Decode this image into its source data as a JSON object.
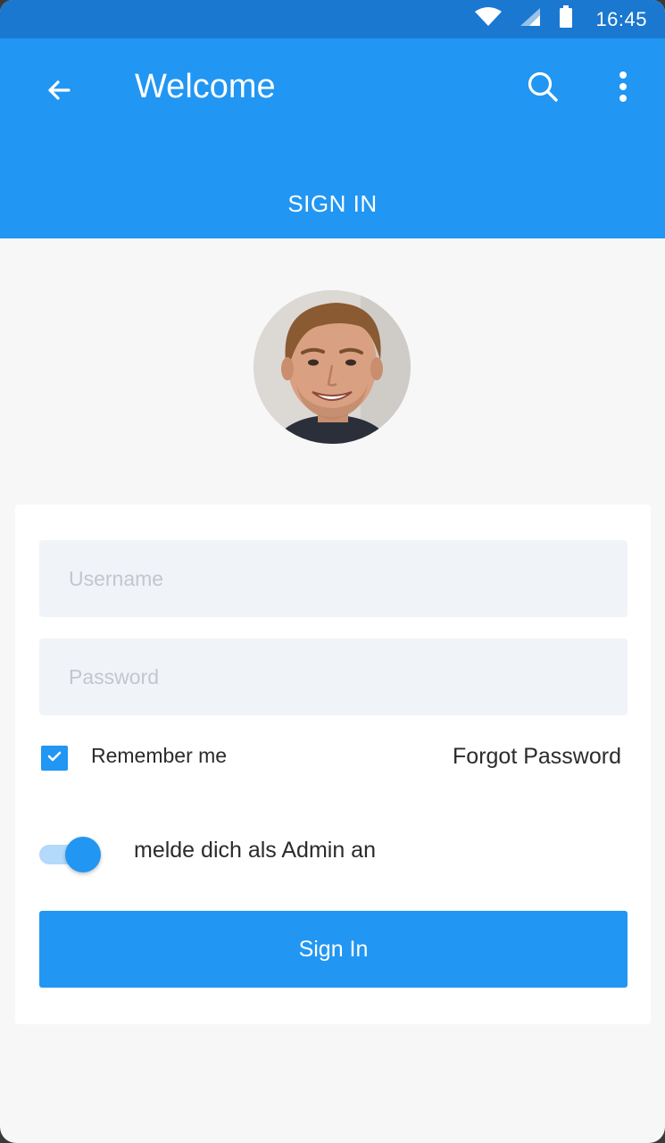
{
  "status_bar": {
    "time": "16:45",
    "icons": [
      "wifi-icon",
      "signal-icon",
      "battery-icon"
    ]
  },
  "app_bar": {
    "title": "Welcome",
    "back_icon": "arrow-left-icon",
    "search_icon": "search-icon",
    "more_icon": "more-vert-icon"
  },
  "tab": {
    "label": "SIGN IN"
  },
  "avatar": {
    "kind": "user-photo"
  },
  "form": {
    "username": {
      "value": "",
      "placeholder": "Username"
    },
    "password": {
      "value": "",
      "placeholder": "Password"
    },
    "remember_me": {
      "label": "Remember me",
      "checked": true
    },
    "forgot_password": "Forgot Password",
    "admin_toggle": {
      "label": "melde dich als Admin an",
      "on": true
    },
    "submit_label": "Sign In"
  },
  "colors": {
    "primary": "#2196f3",
    "status_bar": "#1a78d0",
    "background": "#f7f7f8",
    "field_bg": "#f0f3f8"
  }
}
